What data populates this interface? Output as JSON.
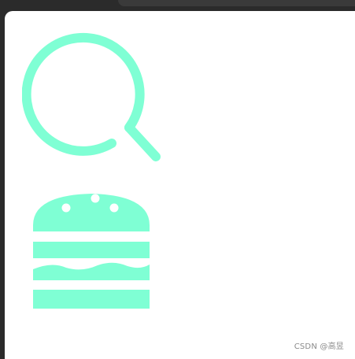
{
  "theme": {
    "icon_color": "#7fffd4",
    "background": "#ffffff",
    "frame": "#2b2b2b"
  },
  "icons": {
    "search": "search-icon",
    "burger": "hamburger-food-icon"
  },
  "watermark": {
    "text": "CSDN @高昱"
  }
}
